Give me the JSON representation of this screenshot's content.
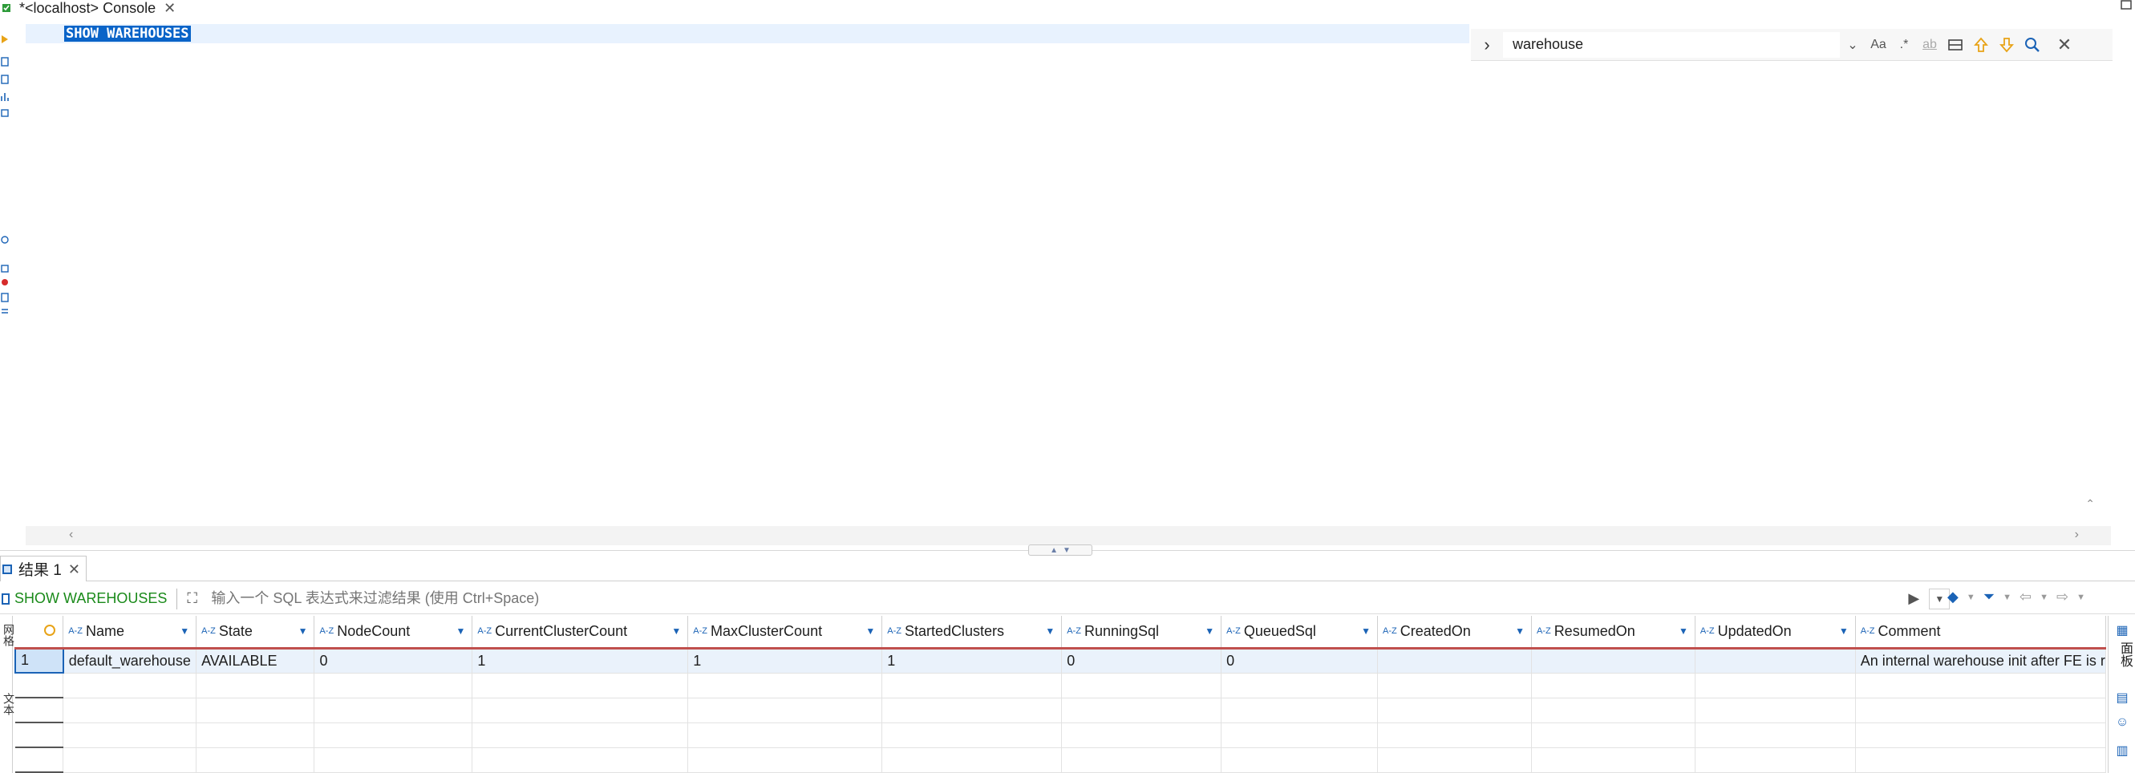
{
  "editor_tab": {
    "title": "*<localhost> Console"
  },
  "editor": {
    "sql": "SHOW WAREHOUSES"
  },
  "find_bar": {
    "query": "warehouse",
    "match_case_label": "Aa",
    "regex_label": ".*",
    "whole_word_label": "ab"
  },
  "results": {
    "tab_label": "结果 1",
    "query_label": "SHOW WAREHOUSES",
    "filter_placeholder": "输入一个 SQL 表达式来过滤结果 (使用 Ctrl+Space)",
    "columns": [
      "Name",
      "State",
      "NodeCount",
      "CurrentClusterCount",
      "MaxClusterCount",
      "StartedClusters",
      "RunningSql",
      "QueuedSql",
      "CreatedOn",
      "ResumedOn",
      "UpdatedOn",
      "Comment"
    ],
    "rows": [
      [
        "1",
        "default_warehouse",
        "AVAILABLE",
        "0",
        "1",
        "1",
        "1",
        "0",
        "0",
        "",
        "",
        "",
        "An internal warehouse init after FE is r"
      ]
    ],
    "side_panel_label": "面板",
    "left_side_tabs": [
      "网格",
      "文本"
    ]
  },
  "colors": {
    "selection": "#0a64c8",
    "accent": "#1b63b6",
    "header_underline": "#c0504d",
    "row_highlight": "#eaf2fb"
  },
  "icons": [
    "console-icon",
    "close-icon",
    "expand-icon",
    "search-icon",
    "arrow-up-icon",
    "arrow-down-icon",
    "filter-icon",
    "eraser-icon",
    "play-icon"
  ]
}
